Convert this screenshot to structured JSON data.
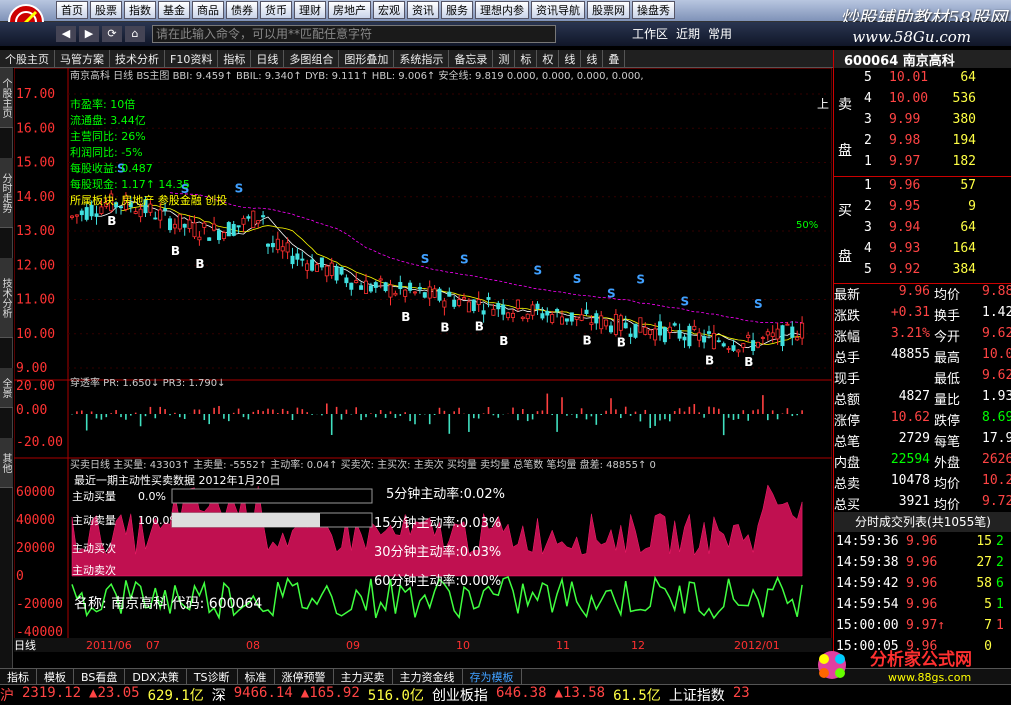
{
  "menu": [
    "首页",
    "股票",
    "指数",
    "基金",
    "商品",
    "债券",
    "货币",
    "理财",
    "房地产",
    "宏观",
    "资讯",
    "服务",
    "理想内参",
    "资讯导航",
    "股票网",
    "操盘秀"
  ],
  "brand": {
    "title": "炒股辅助教材58股网",
    "url": "www.58Gu.com"
  },
  "command_input": {
    "placeholder": "请在此输入命令，可以用**匹配任意字符"
  },
  "row2_right": [
    "工作区",
    "近期",
    "常用"
  ],
  "toolbar": [
    "个股主页",
    "马管方案",
    "技术分析",
    "F10资料",
    "指标",
    "日线",
    "多图组合",
    "图形叠加",
    "系统指示",
    "备忘录",
    "测",
    "标",
    "权",
    "线",
    "线",
    "叠"
  ],
  "left_tabs": [
    "个股主页",
    "分时走势",
    "技术分析",
    "全景",
    "其他"
  ],
  "stock": {
    "code": "600064",
    "name": "南京高科"
  },
  "chart": {
    "header": "南京高科 日线 BS主图 BBI: 9.459↑ BBIL: 9.340↑ DYB: 9.111↑ HBL: 9.006↑ 安全线: 9.819 0.000, 0.000, 0.000, 0.000,",
    "info_lines": [
      "市盈率:     10倍",
      "流通盘:     3.44亿",
      "主营同比:   26%",
      "利润同比:   -5%",
      "每股收益:   0.487",
      "每股现金:   1.17↑ 14.35",
      "所属板块: 房地产 参股金融 创投"
    ],
    "price_ticks": [
      "17.00",
      "16.00",
      "15.00",
      "14.00",
      "13.00",
      "12.00",
      "11.00",
      "10.00",
      "9.00"
    ],
    "pct_label": "50%",
    "right_label": "上",
    "ind1_header": "穿透率 PR: 1.650↓ PR3: 1.790↓",
    "ind1_ticks": [
      "20.00",
      "0.00",
      "-20.00"
    ],
    "ind2_header": "买卖日线 主买量: 43303↑ 主卖量: -5552↑ 主动率: 0.04↑ 买卖次: 主买次: 主卖次 买均量 卖均量 总笔数 笔均量 盘差: 48855↑ 0",
    "ind2_sub": "最近一期主动性买卖数据 2012年1月20日",
    "ind2_ticks": [
      "60000",
      "40000",
      "20000",
      "0",
      "-20000",
      "-40000"
    ],
    "active_rows": [
      {
        "label": "主动买量",
        "value": "0.0%",
        "fill": 0.0
      },
      {
        "label": "主动卖量",
        "value": "100.0%",
        "fill": 1.0
      }
    ],
    "active_labels": [
      "主动买次",
      "主动卖次"
    ],
    "rates": [
      "5分钟主动率:0.02%",
      "15分钟主动率:0.03%",
      "30分钟主动率:0.03%",
      "60分钟主动率:0.00%"
    ],
    "name_code": "名称: 南京高科 代码: 600064",
    "date_axis": [
      "日线",
      "2011/06",
      "07",
      "08",
      "09",
      "10",
      "11",
      "12",
      "2012/01"
    ],
    "bs_marks": [
      "S",
      "S",
      "S",
      "B",
      "B",
      "B",
      "S",
      "S",
      "S",
      "S",
      "S",
      "S",
      "B",
      "B",
      "B",
      "B",
      "B",
      "B",
      "S",
      "S",
      "B",
      "B"
    ]
  },
  "orderbook": {
    "title_code": "600064 南京高科",
    "sell_label": [
      "卖",
      "盘"
    ],
    "buy_label": [
      "买",
      "盘"
    ],
    "sell": [
      {
        "lvl": "5",
        "px": "10.01",
        "vol": "64"
      },
      {
        "lvl": "4",
        "px": "10.00",
        "vol": "536"
      },
      {
        "lvl": "3",
        "px": "9.99",
        "vol": "380"
      },
      {
        "lvl": "2",
        "px": "9.98",
        "vol": "194"
      },
      {
        "lvl": "1",
        "px": "9.97",
        "vol": "182"
      }
    ],
    "buy": [
      {
        "lvl": "1",
        "px": "9.96",
        "vol": "57"
      },
      {
        "lvl": "2",
        "px": "9.95",
        "vol": "9"
      },
      {
        "lvl": "3",
        "px": "9.94",
        "vol": "64"
      },
      {
        "lvl": "4",
        "px": "9.93",
        "vol": "164"
      },
      {
        "lvl": "5",
        "px": "9.92",
        "vol": "384"
      }
    ]
  },
  "stats": [
    {
      "l1": "最新",
      "v1": "9.96",
      "c1": "#ff4444",
      "l2": "均价",
      "v2": "9.88",
      "c2": "#ff4444"
    },
    {
      "l1": "涨跌",
      "v1": "+0.31",
      "c1": "#ff4444",
      "l2": "换手",
      "v2": "1.42%",
      "c2": "#ffffff"
    },
    {
      "l1": "涨幅",
      "v1": "3.21%",
      "c1": "#ff4444",
      "l2": "今开",
      "v2": "9.62",
      "c2": "#ff4444"
    },
    {
      "l1": "总手",
      "v1": "48855",
      "c1": "#ffffff",
      "l2": "最高",
      "v2": "10.01",
      "c2": "#ff4444"
    },
    {
      "l1": "现手",
      "v1": "",
      "c1": "#ffffff",
      "l2": "最低",
      "v2": "9.62",
      "c2": "#ff4444"
    },
    {
      "l1": "总额",
      "v1": "4827",
      "c1": "#ffffff",
      "l2": "量比",
      "v2": "1.93",
      "c2": "#ffffff"
    },
    {
      "l1": "涨停",
      "v1": "10.62",
      "c1": "#ff4444",
      "l2": "跌停",
      "v2": "8.69",
      "c2": "#00ff00"
    },
    {
      "l1": "总笔",
      "v1": "2729",
      "c1": "#ffffff",
      "l2": "每笔",
      "v2": "17.9",
      "c2": "#ffffff"
    },
    {
      "l1": "内盘",
      "v1": "22594",
      "c1": "#00ff00",
      "l2": "外盘",
      "v2": "26261",
      "c2": "#ff4444"
    },
    {
      "l1": "总卖",
      "v1": "10478",
      "c1": "#ffffff",
      "l2": "均价",
      "v2": "10.25",
      "c2": "#ff4444"
    },
    {
      "l1": "总买",
      "v1": "3921",
      "c1": "#ffffff",
      "l2": "均价",
      "v2": "9.72",
      "c2": "#ff4444"
    }
  ],
  "ticks_title": "分时成交列表(共1055笔)",
  "ticks": [
    {
      "t": "14:59:36",
      "p": "9.96",
      "v": "15",
      "f": "2"
    },
    {
      "t": "14:59:38",
      "p": "9.96",
      "v": "27",
      "f": "2"
    },
    {
      "t": "14:59:42",
      "p": "9.96",
      "v": "58",
      "f": "6"
    },
    {
      "t": "14:59:54",
      "p": "9.96",
      "v": "5",
      "f": "1"
    },
    {
      "t": "15:00:00",
      "p": "9.97↑",
      "v": "7",
      "f": "1"
    },
    {
      "t": "15:00:05",
      "p": "9.96",
      "v": "0",
      "f": ""
    }
  ],
  "bottom_tabs": [
    "指标",
    "模板",
    "BS看盘",
    "DDX决策",
    "TS诊断",
    "标准",
    "涨停预警",
    "主力买卖",
    "主力资金线",
    "存为模板"
  ],
  "ticker": [
    {
      "t": "沪",
      "c": "#ff4444"
    },
    {
      "t": "2319.12",
      "c": "#ff4444"
    },
    {
      "t": "▲23.05",
      "c": "#ff4444"
    },
    {
      "t": "629.1亿",
      "c": "#ffff44"
    },
    {
      "t": "深",
      "c": "#ffffff"
    },
    {
      "t": "9466.14",
      "c": "#ff4444"
    },
    {
      "t": "▲165.92",
      "c": "#ff4444"
    },
    {
      "t": "516.0亿",
      "c": "#ffff44"
    },
    {
      "t": "创业板指",
      "c": "#ffffff"
    },
    {
      "t": "646.38",
      "c": "#ff4444"
    },
    {
      "t": "▲13.58",
      "c": "#ff4444"
    },
    {
      "t": "61.5亿",
      "c": "#ffff44"
    },
    {
      "t": "上证指数",
      "c": "#ffffff"
    },
    {
      "t": "23",
      "c": "#ff4444"
    }
  ],
  "badge": {
    "title": "分析家公式网",
    "url": "www.88gs.com"
  }
}
